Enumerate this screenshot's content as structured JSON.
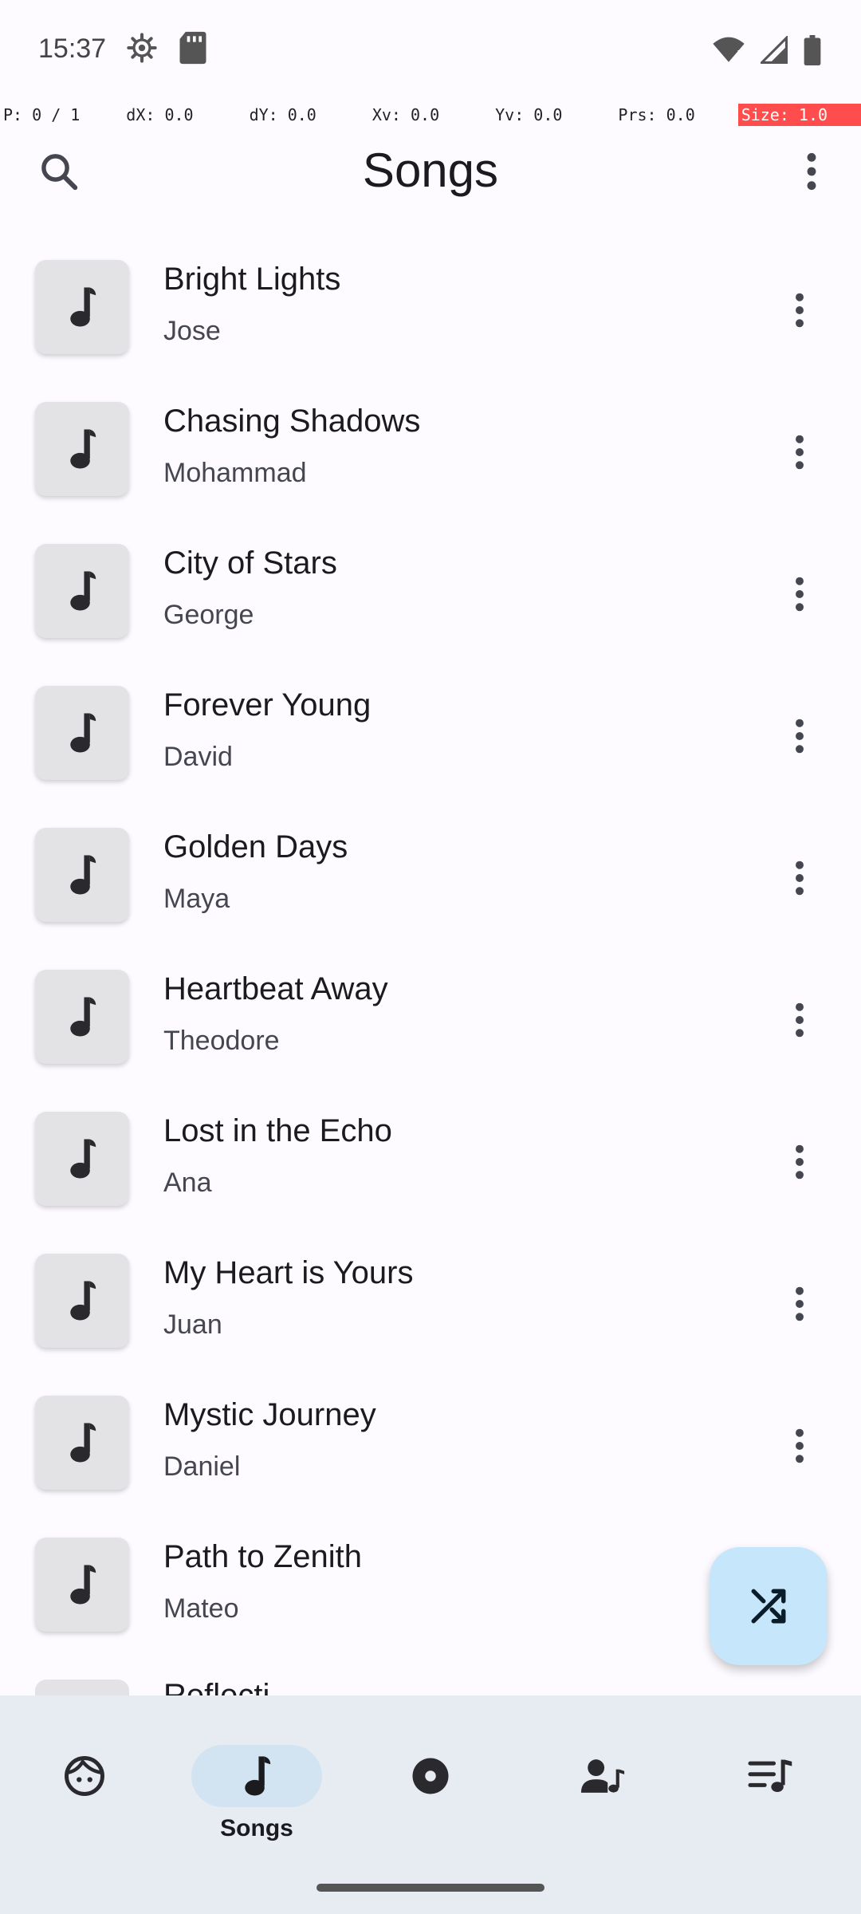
{
  "status_bar": {
    "time": "15:37",
    "left_icons": [
      "settings-icon",
      "sd-card-icon"
    ],
    "right_icons": [
      "wifi-alert-icon",
      "signal-icon",
      "battery-icon"
    ]
  },
  "pointer_overlay": {
    "p": "P: 0 / 1",
    "dx": "dX: 0.0",
    "dy": "dY: 0.0",
    "xv": "Xv: 0.0",
    "yv": "Yv: 0.0",
    "prs": "Prs: 0.0",
    "size": "Size: 1.0"
  },
  "app_bar": {
    "title": "Songs",
    "search_icon": "search-icon",
    "more_icon": "more-vert-icon"
  },
  "songs": [
    {
      "title": "Bright Lights",
      "artist": "Jose"
    },
    {
      "title": "Chasing Shadows",
      "artist": "Mohammad"
    },
    {
      "title": "City of Stars",
      "artist": "George"
    },
    {
      "title": "Forever Young",
      "artist": "David"
    },
    {
      "title": "Golden Days",
      "artist": "Maya"
    },
    {
      "title": "Heartbeat Away",
      "artist": "Theodore"
    },
    {
      "title": "Lost in the Echo",
      "artist": "Ana"
    },
    {
      "title": "My Heart is Yours",
      "artist": "Juan"
    },
    {
      "title": "Mystic Journey",
      "artist": "Daniel"
    },
    {
      "title": "Path to Zenith",
      "artist": "Mateo"
    }
  ],
  "partial_song": {
    "title": "Reflecti..."
  },
  "fab": {
    "icon": "shuffle-icon"
  },
  "bottom_nav": {
    "items": [
      {
        "icon": "face-icon",
        "label": ""
      },
      {
        "icon": "music-note-icon",
        "label": "Songs"
      },
      {
        "icon": "album-icon",
        "label": ""
      },
      {
        "icon": "artist-icon",
        "label": ""
      },
      {
        "icon": "playlist-icon",
        "label": ""
      }
    ]
  },
  "colors": {
    "background": "#fdfbff",
    "nav_background": "#e7ebf2",
    "fab": "#c6e7fb",
    "active_pill": "#d2e4f2"
  }
}
